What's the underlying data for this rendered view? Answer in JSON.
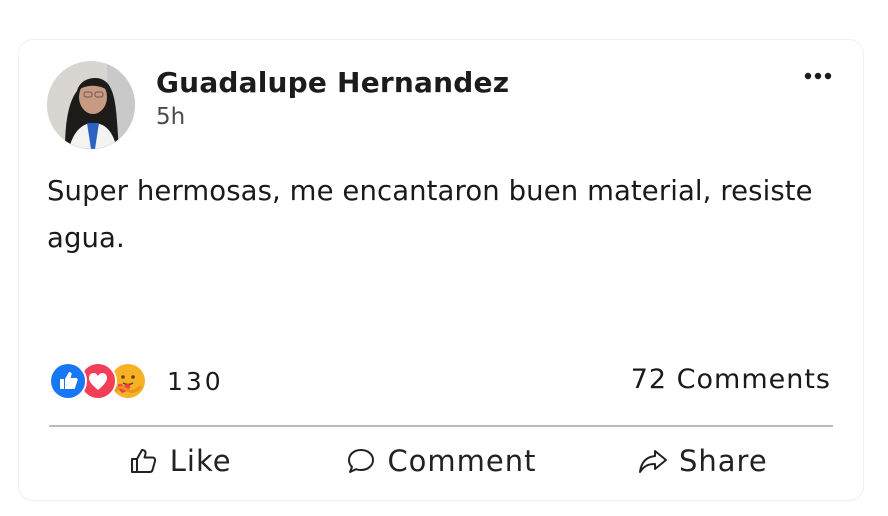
{
  "post": {
    "author": "Guadalupe Hernandez",
    "time": "5h",
    "text": "Super hermosas, me encantaron buen material, resiste agua.",
    "more_icon": "more-horizontal-icon"
  },
  "reactions": {
    "icons": [
      "like-reaction-icon",
      "love-reaction-icon",
      "care-reaction-icon"
    ],
    "count": "130",
    "colors": {
      "like": "#1877f2",
      "love": "#f33e58",
      "care": "#f7b125"
    }
  },
  "comments": {
    "count_label": "72 Comments"
  },
  "actions": {
    "like_label": "Like",
    "comment_label": "Comment",
    "share_label": "Share"
  }
}
